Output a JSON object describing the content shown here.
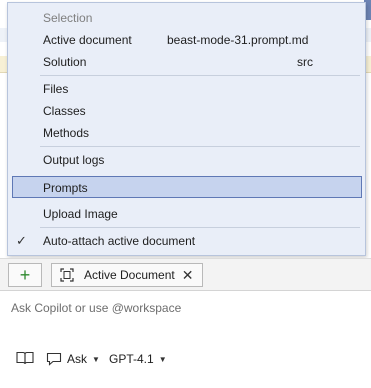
{
  "menu": {
    "header": "Selection",
    "active_document": {
      "label": "Active document",
      "value": "beast-mode-31.prompt.md"
    },
    "solution": {
      "label": "Solution",
      "value": "src"
    },
    "files": "Files",
    "classes": "Classes",
    "methods": "Methods",
    "output_logs": "Output logs",
    "prompts": "Prompts",
    "upload_image": "Upload Image",
    "auto_attach": {
      "label": "Auto-attach active document",
      "checked": true
    }
  },
  "toolbar": {
    "add_label": "+",
    "context_chip": "Active Document",
    "chip_close": "✕"
  },
  "input": {
    "placeholder": "Ask Copilot or use @workspace"
  },
  "bottom": {
    "mode": "Ask",
    "model": "GPT-4.1"
  },
  "colors": {
    "menu_bg": "#e9eef8",
    "selected_bg": "#c6d3ee",
    "selected_border": "#5f78b5",
    "add_icon": "#2f8a2f"
  }
}
